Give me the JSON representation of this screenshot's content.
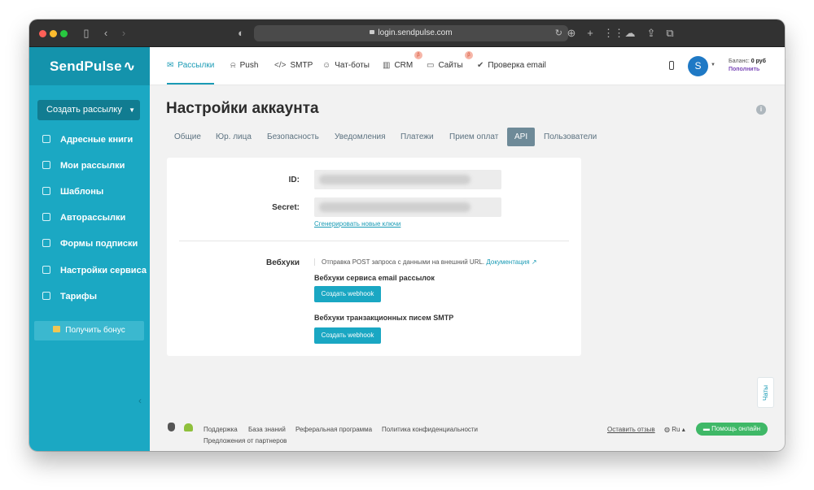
{
  "browser": {
    "url": "login.sendpulse.com"
  },
  "brand": {
    "name": "SendPulse",
    "accent": "#1ba8c3"
  },
  "sidebar": {
    "create_button": "Создать рассылку",
    "items": [
      {
        "label": "Адресные книги",
        "icon": "address-book-icon"
      },
      {
        "label": "Мои рассылки",
        "icon": "campaigns-icon"
      },
      {
        "label": "Шаблоны",
        "icon": "templates-icon"
      },
      {
        "label": "Авторассылки",
        "icon": "automation-icon"
      },
      {
        "label": "Формы подписки",
        "icon": "forms-icon"
      },
      {
        "label": "Настройки сервиса",
        "icon": "settings-icon"
      },
      {
        "label": "Тарифы",
        "icon": "pricing-icon"
      }
    ],
    "bonus_button": "Получить бонус"
  },
  "topnav": {
    "items": [
      {
        "label": "Рассылки",
        "icon": "✉"
      },
      {
        "label": "Push",
        "icon": "🔔"
      },
      {
        "label": "SMTP",
        "icon": "</>"
      },
      {
        "label": "Чат-боты",
        "icon": "☺"
      },
      {
        "label": "CRM",
        "icon": "▥"
      },
      {
        "label": "Сайты",
        "icon": "▭"
      },
      {
        "label": "Проверка email",
        "icon": "✔"
      }
    ],
    "beta_badge": "β",
    "avatar_letter": "S",
    "balance_label": "Баланс:",
    "balance_value": "0 руб",
    "topup_label": "Пополнить"
  },
  "page": {
    "title": "Настройки аккаунта",
    "tabs": [
      "Общие",
      "Юр. лица",
      "Безопасность",
      "Уведомления",
      "Платежи",
      "Прием оплат",
      "API",
      "Пользователи"
    ],
    "active_tab": "API"
  },
  "api": {
    "id_label": "ID:",
    "secret_label": "Secret:",
    "generate_link": "Сгенерировать новые ключи",
    "webhooks_label": "Вебхуки",
    "webhooks_note": "Отправка POST запроса с данными на внешний URL.",
    "docs_link": "Документация",
    "email_section_title": "Вебхуки сервиса email рассылок",
    "smtp_section_title": "Вебхуки транзакционных писем SMTP",
    "create_webhook_button": "Создать webhook"
  },
  "chats_tab": "Чаты",
  "footer": {
    "links": [
      "Поддержка",
      "База знаний",
      "Реферальная программа",
      "Политика конфиденциальности"
    ],
    "partners_link": "Предложения от партнеров",
    "feedback_link": "Оставить отзыв",
    "language": "Ru",
    "help_button": "Помощь онлайн"
  }
}
